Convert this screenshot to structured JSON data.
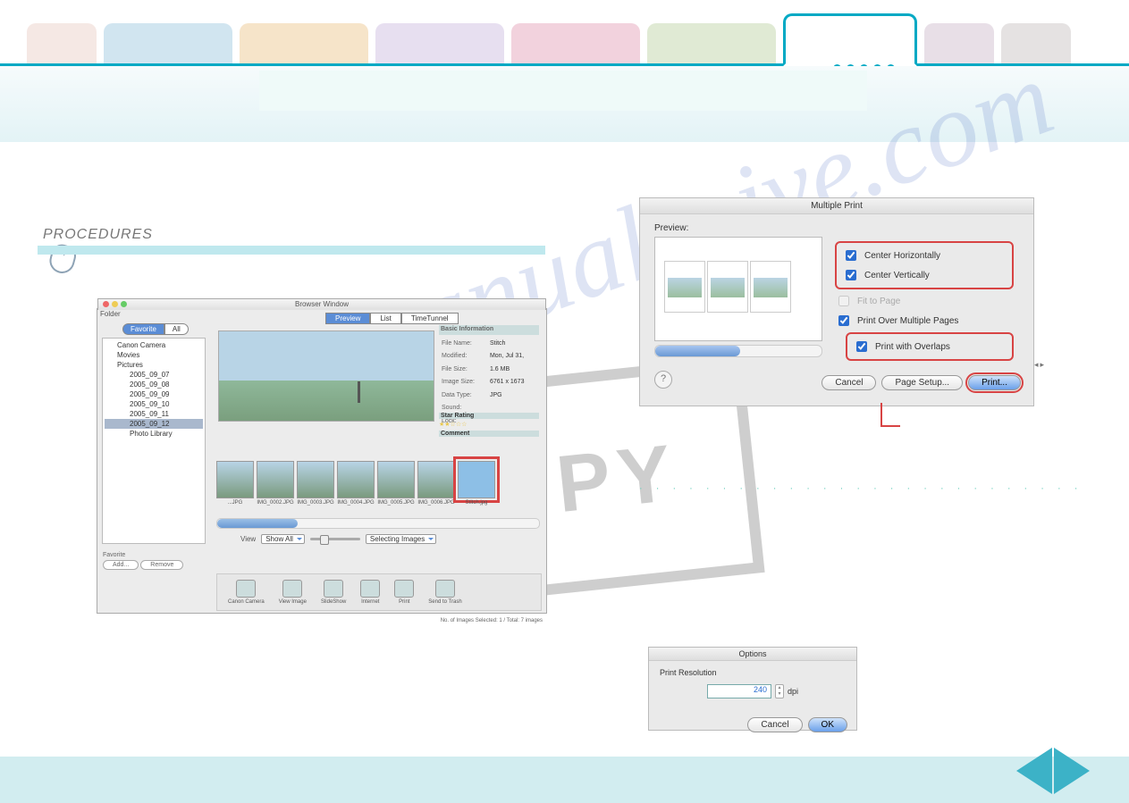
{
  "tabs": [
    "",
    "",
    "",
    "",
    "",
    "",
    "",
    "",
    ""
  ],
  "procedures_label": "PROCEDURES",
  "browser": {
    "title": "Browser Window",
    "folder_header": "Folder",
    "seg": [
      "Favorite",
      "All"
    ],
    "tree": [
      {
        "label": "Canon Camera",
        "in": false
      },
      {
        "label": "Movies",
        "in": false
      },
      {
        "label": "Pictures",
        "in": false
      },
      {
        "label": "2005_09_07",
        "in": true
      },
      {
        "label": "2005_09_08",
        "in": true
      },
      {
        "label": "2005_09_09",
        "in": true
      },
      {
        "label": "2005_09_10",
        "in": true
      },
      {
        "label": "2005_09_11",
        "in": true
      },
      {
        "label": "2005_09_12",
        "in": true,
        "sel": true
      },
      {
        "label": "Photo Library",
        "in": true
      }
    ],
    "viewmode": [
      "Preview",
      "List",
      "TimeTunnel"
    ],
    "info_header": "Basic Information",
    "info": [
      [
        "File Name:",
        "Stitch"
      ],
      [
        "Modified:",
        "Mon, Jul 31,"
      ],
      [
        "File Size:",
        "1.6 MB"
      ],
      [
        "Image Size:",
        "6761 x 1673"
      ],
      [
        "Data Type:",
        "JPG"
      ],
      [
        "Sound:",
        ""
      ],
      [
        "Lock:",
        ""
      ]
    ],
    "star_label": "Star Rating",
    "comment_label": "Comment",
    "thumbs": [
      "...JPG",
      "IMG_0002.JPG",
      "IMG_0003.JPG",
      "IMG_0004.JPG",
      "IMG_0005.JPG",
      "IMG_0006.JPG",
      "Stitch.jpg"
    ],
    "view_label": "View",
    "showall": "Show All",
    "selecting": "Selecting Images",
    "toolbar": [
      "Canon Camera",
      "View Image",
      "SlideShow",
      "Internet",
      "Print",
      "Send to Trash"
    ],
    "favorite_label": "Favorite",
    "fav_buttons": [
      "Add...",
      "Remove"
    ],
    "status": "No. of Images Selected: 1 / Total: 7 images"
  },
  "multiple_print": {
    "title": "Multiple Print",
    "preview_label": "Preview:",
    "opts": {
      "center_h": "Center Horizontally",
      "center_v": "Center Vertically",
      "fit": "Fit to Page",
      "multi": "Print Over Multiple Pages",
      "overlaps": "Print with Overlaps"
    },
    "buttons": {
      "cancel": "Cancel",
      "setup": "Page Setup...",
      "print": "Print..."
    },
    "help": "?"
  },
  "options_dialog": {
    "title": "Options",
    "label": "Print Resolution",
    "value": "240",
    "unit": "dpi",
    "cancel": "Cancel",
    "ok": "OK"
  },
  "watermark": "manualsnive.com",
  "copystamp": "COPY"
}
